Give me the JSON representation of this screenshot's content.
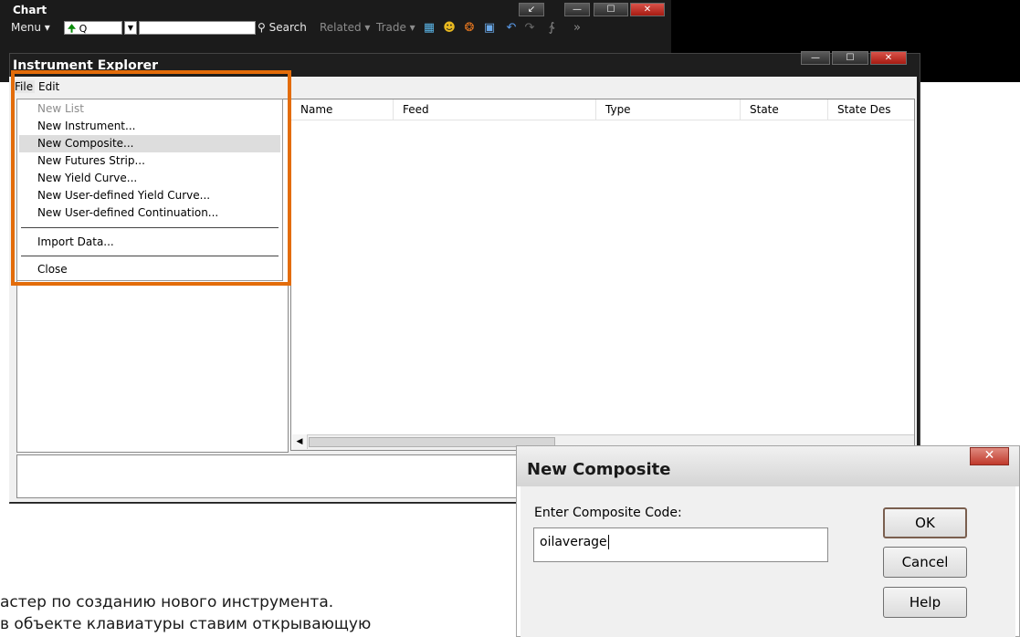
{
  "chart_window": {
    "title": "Chart",
    "menu_label": "Menu ▾",
    "symbol_value": "Q",
    "search_label": "Search",
    "related_label": "Related ▾",
    "trade_label": "Trade ▾",
    "controls": {
      "restore": "↙",
      "minimize": "—",
      "maximize": "☐",
      "close": "✕"
    }
  },
  "explorer": {
    "title": "Instrument Explorer",
    "menubar": {
      "file": "File",
      "edit": "Edit"
    },
    "columns": [
      "Name",
      "Feed",
      "Type",
      "State",
      "State Des"
    ],
    "controls": {
      "minimize": "—",
      "maximize": "☐",
      "close": "✕"
    }
  },
  "file_menu": {
    "items": [
      {
        "label": "New List",
        "disabled": true
      },
      {
        "label": "New Instrument..."
      },
      {
        "label": "New Composite...",
        "highlighted": true
      },
      {
        "label": "New Futures Strip..."
      },
      {
        "label": "New Yield Curve..."
      },
      {
        "label": "New User-defined Yield Curve..."
      },
      {
        "label": "New User-defined Continuation..."
      },
      {
        "label": "Import Data..."
      },
      {
        "label": "Close"
      }
    ]
  },
  "dialog": {
    "title": "New Composite",
    "close_glyph": "✕",
    "label": "Enter Composite Code:",
    "input_value": "oilaverage",
    "ok_label": "OK",
    "cancel_label": "Cancel",
    "help_label": "Help"
  },
  "caption": {
    "line1": "астер по созданию нового инструмента.",
    "line2": "в объекте клавиатуры ставим открывающую"
  },
  "colors": {
    "highlight_frame": "#e36c0a",
    "window_dark": "#1e1e1e",
    "dialog_close": "#c0392b"
  }
}
